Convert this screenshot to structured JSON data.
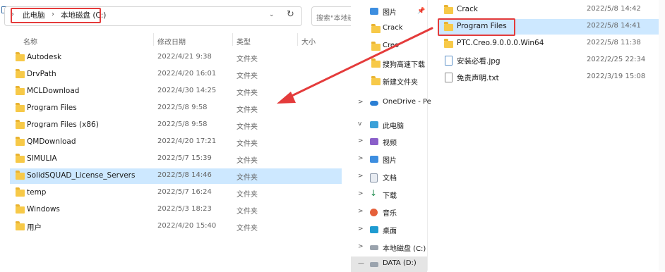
{
  "left": {
    "breadcrumb": [
      "此电脑",
      "本地磁盘 (C:)"
    ],
    "search_placeholder": "搜索\"本地磁盘",
    "columns": {
      "name": "名称",
      "date": "修改日期",
      "type": "类型",
      "size": "大小"
    },
    "rows": [
      {
        "name": "Autodesk",
        "date": "2022/4/21 9:38",
        "type": "文件夹",
        "selected": false
      },
      {
        "name": "DrvPath",
        "date": "2022/4/20 16:01",
        "type": "文件夹",
        "selected": false
      },
      {
        "name": "MCLDownload",
        "date": "2022/4/30 14:25",
        "type": "文件夹",
        "selected": false
      },
      {
        "name": "Program Files",
        "date": "2022/5/8 9:58",
        "type": "文件夹",
        "selected": false
      },
      {
        "name": "Program Files (x86)",
        "date": "2022/5/8 9:58",
        "type": "文件夹",
        "selected": false
      },
      {
        "name": "QMDownload",
        "date": "2022/4/20 17:21",
        "type": "文件夹",
        "selected": false
      },
      {
        "name": "SIMULIA",
        "date": "2022/5/7 15:39",
        "type": "文件夹",
        "selected": false
      },
      {
        "name": "SolidSQUAD_License_Servers",
        "date": "2022/5/8 14:46",
        "type": "文件夹",
        "selected": true
      },
      {
        "name": "temp",
        "date": "2022/5/7 16:24",
        "type": "文件夹",
        "selected": false
      },
      {
        "name": "Windows",
        "date": "2022/5/3 18:23",
        "type": "文件夹",
        "selected": false
      },
      {
        "name": "用户",
        "date": "2022/4/20 15:40",
        "type": "文件夹",
        "selected": false
      }
    ]
  },
  "right": {
    "nav": [
      {
        "label": "图片",
        "icon": "pictures-icon",
        "chevron": "",
        "pinned": true
      },
      {
        "label": "Crack",
        "icon": "folder-icon",
        "chevron": ""
      },
      {
        "label": "Creo",
        "icon": "folder-icon",
        "chevron": ""
      },
      {
        "label": "搜狗高速下载",
        "icon": "folder-icon",
        "chevron": ""
      },
      {
        "label": "新建文件夹",
        "icon": "folder-icon",
        "chevron": ""
      },
      {
        "label": "OneDrive - Pe",
        "icon": "onedrive-icon",
        "chevron": ">"
      },
      {
        "label": "此电脑",
        "icon": "this-pc-icon",
        "chevron": "v"
      },
      {
        "label": "视频",
        "icon": "videos-icon",
        "chevron": ">"
      },
      {
        "label": "图片",
        "icon": "pictures-icon",
        "chevron": ">"
      },
      {
        "label": "文档",
        "icon": "documents-icon",
        "chevron": ">"
      },
      {
        "label": "下载",
        "icon": "downloads-icon",
        "chevron": ">"
      },
      {
        "label": "音乐",
        "icon": "music-icon",
        "chevron": ">"
      },
      {
        "label": "桌面",
        "icon": "desktop-icon",
        "chevron": ">"
      },
      {
        "label": "本地磁盘 (C:)",
        "icon": "drive-icon",
        "chevron": ">"
      },
      {
        "label": "DATA (D:)",
        "icon": "drive-icon",
        "chevron": "—",
        "selected": true
      }
    ],
    "files": [
      {
        "name": "Crack",
        "date": "2022/5/8 14:42",
        "kind": "folder",
        "selected": false
      },
      {
        "name": "Program Files",
        "date": "2022/5/8 14:41",
        "kind": "folder",
        "selected": true
      },
      {
        "name": "PTC.Creo.9.0.0.0.Win64",
        "date": "2022/5/8 11:38",
        "kind": "folder",
        "selected": false
      },
      {
        "name": "安装必看.jpg",
        "date": "2022/2/25 22:34",
        "kind": "image",
        "selected": false
      },
      {
        "name": "免责声明.txt",
        "date": "2022/3/19 15:08",
        "kind": "text",
        "selected": false
      }
    ]
  },
  "colors": {
    "accent_red": "#e43b3b",
    "selection": "#cde8ff",
    "folder": "#f7c948"
  }
}
